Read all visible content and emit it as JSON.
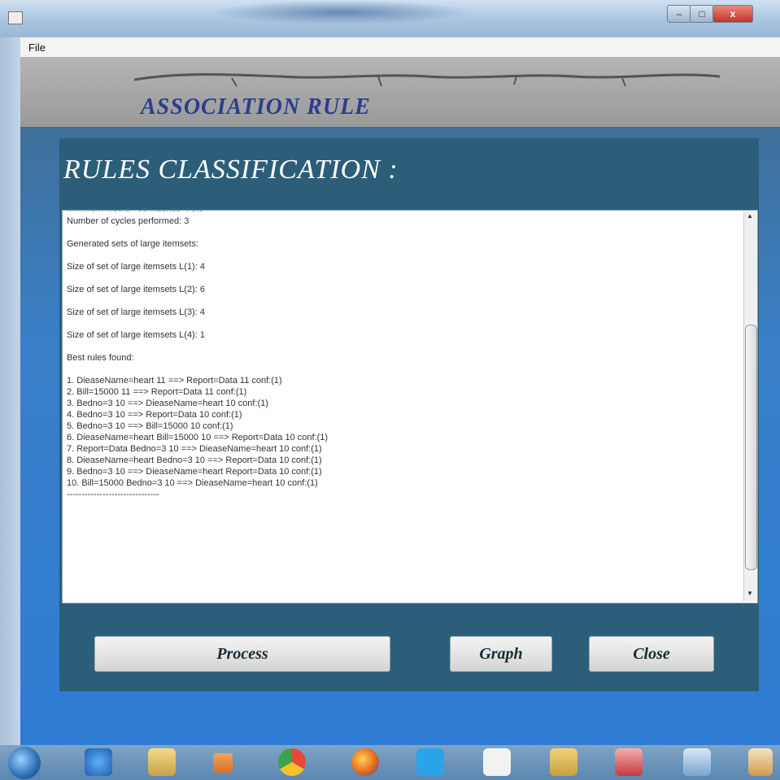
{
  "window": {
    "title": ""
  },
  "menu": {
    "file": "File"
  },
  "banner": {
    "title": "ASSOCIATION RULE"
  },
  "panel": {
    "title": "RULES CLASSIFICATION :",
    "output": {
      "cycles": "Number of cycles performed: 3",
      "generated": "Generated sets of large itemsets:",
      "sizes": [
        "Size of set of large itemsets L(1): 4",
        "Size of set of large itemsets L(2): 6",
        "Size of set of large itemsets L(3): 4",
        "Size of set of large itemsets L(4): 1"
      ],
      "best_rules": "Best rules found:",
      "rules": [
        " 1. DieaseName=heart 11 ==> Report=Data 11    conf:(1)",
        " 2. Bill=15000 11 ==> Report=Data 11    conf:(1)",
        " 3. Bedno=3 10 ==> DieaseName=heart 10    conf:(1)",
        " 4. Bedno=3 10 ==> Report=Data 10    conf:(1)",
        " 5. Bedno=3 10 ==> Bill=15000 10    conf:(1)",
        " 6. DieaseName=heart Bill=15000 10 ==> Report=Data 10    conf:(1)",
        " 7. Report=Data Bedno=3 10 ==> DieaseName=heart 10    conf:(1)",
        " 8. DieaseName=heart Bedno=3 10 ==> Report=Data 10    conf:(1)",
        " 9. Bedno=3 10 ==> DieaseName=heart Report=Data 10    conf:(1)",
        "10. Bill=15000 Bedno=3 10 ==> DieaseName=heart 10    conf:(1)"
      ],
      "separator": "-------------------------------"
    }
  },
  "buttons": {
    "process": "Process",
    "graph": "Graph",
    "close": "Close"
  },
  "taskbar": {
    "icons": [
      "windows-start-icon",
      "internet-explorer-icon",
      "file-explorer-icon",
      "media-player-icon",
      "chrome-icon",
      "firefox-icon",
      "skype-icon",
      "airtel-icon",
      "app-icon",
      "acrobat-icon",
      "box-icon",
      "java-icon"
    ]
  }
}
